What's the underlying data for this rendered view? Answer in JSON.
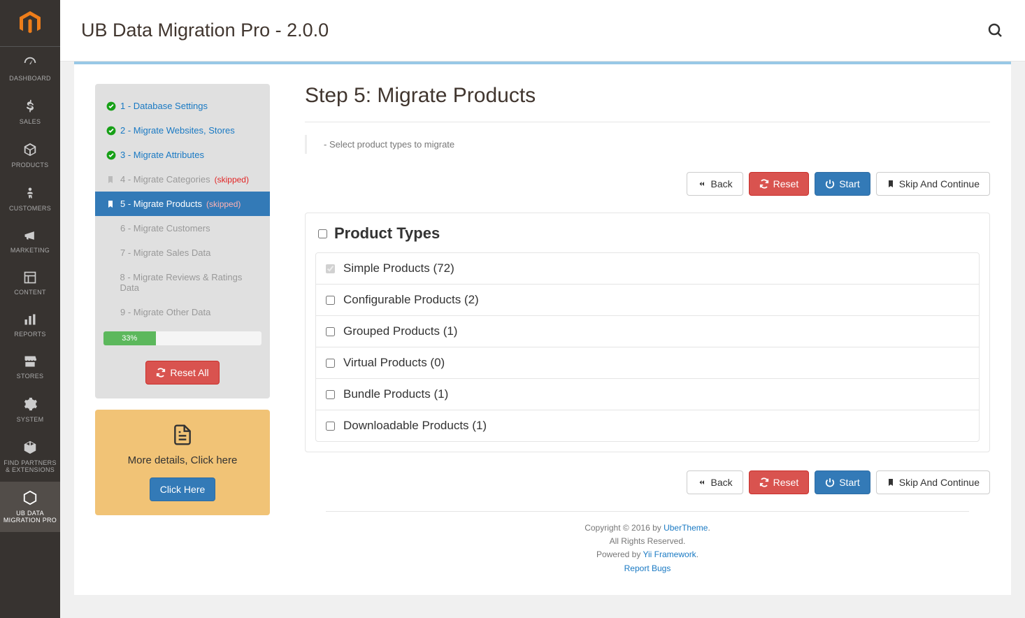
{
  "header": {
    "title": "UB Data Migration Pro - 2.0.0"
  },
  "nav": {
    "items": [
      {
        "label": "DASHBOARD",
        "icon": "gauge"
      },
      {
        "label": "SALES",
        "icon": "dollar"
      },
      {
        "label": "PRODUCTS",
        "icon": "cube"
      },
      {
        "label": "CUSTOMERS",
        "icon": "person"
      },
      {
        "label": "MARKETING",
        "icon": "megaphone"
      },
      {
        "label": "CONTENT",
        "icon": "layout"
      },
      {
        "label": "REPORTS",
        "icon": "bars"
      },
      {
        "label": "STORES",
        "icon": "storefront"
      },
      {
        "label": "SYSTEM",
        "icon": "gear"
      },
      {
        "label": "FIND PARTNERS & EXTENSIONS",
        "icon": "package"
      },
      {
        "label": "UB DATA MIGRATION PRO",
        "icon": "hex"
      }
    ],
    "active_index": 10
  },
  "steps": [
    {
      "label": "1 - Database Settings",
      "status": "done"
    },
    {
      "label": "2 - Migrate Websites, Stores",
      "status": "done"
    },
    {
      "label": "3 - Migrate Attributes",
      "status": "done"
    },
    {
      "label": "4 - Migrate Categories",
      "status": "pending",
      "skipped": "(skipped)"
    },
    {
      "label": "5 - Migrate Products",
      "status": "active",
      "skipped": "(skipped)"
    },
    {
      "label": "6 - Migrate Customers",
      "status": "pending"
    },
    {
      "label": "7 - Migrate Sales Data",
      "status": "pending"
    },
    {
      "label": "8 - Migrate Reviews & Ratings Data",
      "status": "pending"
    },
    {
      "label": "9 - Migrate Other Data",
      "status": "pending"
    }
  ],
  "progress": {
    "pct": 33,
    "label": "33%"
  },
  "reset_all_label": "Reset All",
  "info_card": {
    "text": "More details, Click here",
    "button": "Click Here"
  },
  "main": {
    "title": "Step 5: Migrate Products",
    "instruction": "- Select product types to migrate",
    "buttons": {
      "back": "Back",
      "reset": "Reset",
      "start": "Start",
      "skip": "Skip And Continue"
    },
    "product_types": {
      "heading": "Product Types",
      "rows": [
        {
          "label": "Simple Products (72)",
          "checked": true,
          "disabled": true
        },
        {
          "label": "Configurable Products (2)",
          "checked": false
        },
        {
          "label": "Grouped Products (1)",
          "checked": false
        },
        {
          "label": "Virtual Products (0)",
          "checked": false
        },
        {
          "label": "Bundle Products (1)",
          "checked": false
        },
        {
          "label": "Downloadable Products (1)",
          "checked": false
        }
      ]
    }
  },
  "footer": {
    "line1a": "Copyright © 2016 by ",
    "line1b": "UberTheme",
    "line2": "All Rights Reserved.",
    "line3a": "Powered by ",
    "line3b": "Yii Framework",
    "line4": "Report Bugs"
  }
}
